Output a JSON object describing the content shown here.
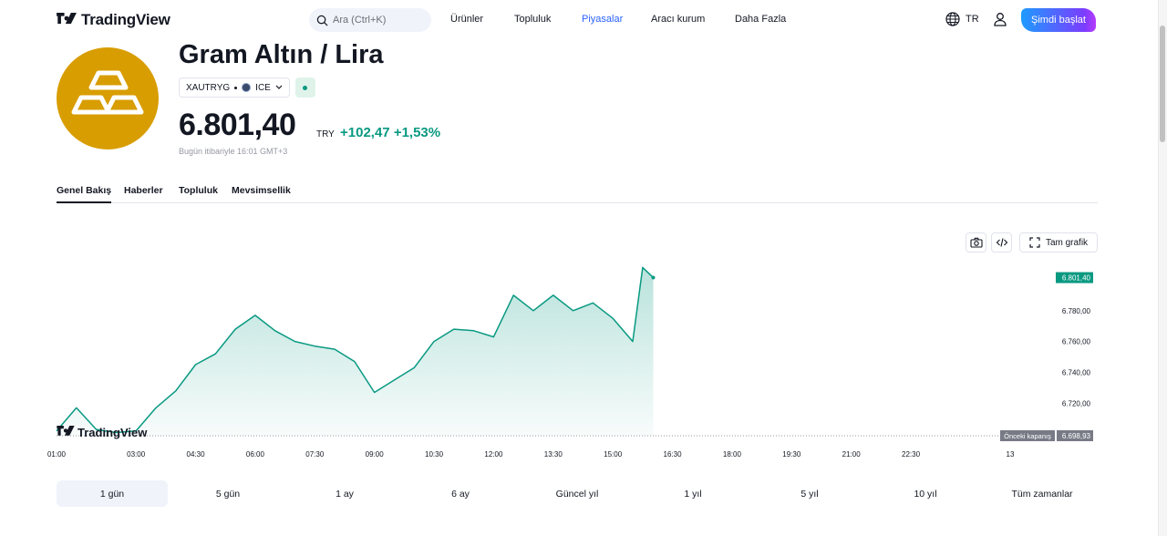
{
  "header": {
    "logo_text": "TradingView",
    "search_placeholder": "Ara (Ctrl+K)",
    "nav": [
      "Ürünler",
      "Topluluk",
      "Piyasalar",
      "Aracı kurum",
      "Daha Fazla"
    ],
    "active_nav": "Piyasalar",
    "language": "TR",
    "cta_label": "Şimdi başlat",
    "accent_color": "#2962ff"
  },
  "asset": {
    "title": "Gram Altın / Lira",
    "symbol": "XAUTRYG",
    "exchange": "ICE",
    "icon": "gold-bars-icon",
    "icon_color": "#d89d00",
    "price": "6.801,40",
    "currency": "TRY",
    "change": "+102,47",
    "change_pct": "+1,53%",
    "change_color": "#089981",
    "as_of": "Bugün itibariyle 16:01 GMT+3"
  },
  "tabs": [
    "Genel Bakış",
    "Haberler",
    "Topluluk",
    "Mevsimsellik"
  ],
  "active_tab": "Genel Bakış",
  "chart_tools": {
    "fullscreen_label": "Tam grafik"
  },
  "chart_data": {
    "type": "area",
    "line_color": "#089981",
    "watermark": "TradingView",
    "x_tick_labels": [
      "01:00",
      "03:00",
      "04:30",
      "06:00",
      "07:30",
      "09:00",
      "10:30",
      "12:00",
      "13:30",
      "15:00",
      "16:30",
      "18:00",
      "19:30",
      "21:00",
      "22:30",
      "13"
    ],
    "y_tick_labels": [
      "6.780,00",
      "6.760,00",
      "6.740,00",
      "6.720,00"
    ],
    "ylim": [
      6698.93,
      6810
    ],
    "last_price_label": "6.801,40",
    "prev_close_title": "Önceki kapanış",
    "prev_close_label": "6.698,93",
    "prev_close": 6698.93,
    "x": [
      "01:00",
      "01:30",
      "02:00",
      "02:30",
      "03:00",
      "03:30",
      "04:00",
      "04:30",
      "05:00",
      "05:30",
      "06:00",
      "06:30",
      "07:00",
      "07:30",
      "08:00",
      "08:30",
      "09:00",
      "09:30",
      "10:00",
      "10:30",
      "11:00",
      "11:30",
      "12:00",
      "12:30",
      "13:00",
      "13:30",
      "14:00",
      "14:30",
      "15:00",
      "15:30",
      "15:45",
      "16:01"
    ],
    "y": [
      6702,
      6717,
      6703,
      6701,
      6702,
      6717,
      6728,
      6745,
      6752,
      6768,
      6777,
      6767,
      6760,
      6757,
      6755,
      6747,
      6727,
      6735,
      6743,
      6760,
      6768,
      6767,
      6763,
      6790,
      6780,
      6790,
      6780,
      6785,
      6775,
      6760,
      6808,
      6801.4
    ]
  },
  "ranges": [
    "1 gün",
    "5 gün",
    "1 ay",
    "6 ay",
    "Güncel yıl",
    "1 yıl",
    "5 yıl",
    "10 yıl",
    "Tüm zamanlar"
  ],
  "active_range": "1 gün"
}
